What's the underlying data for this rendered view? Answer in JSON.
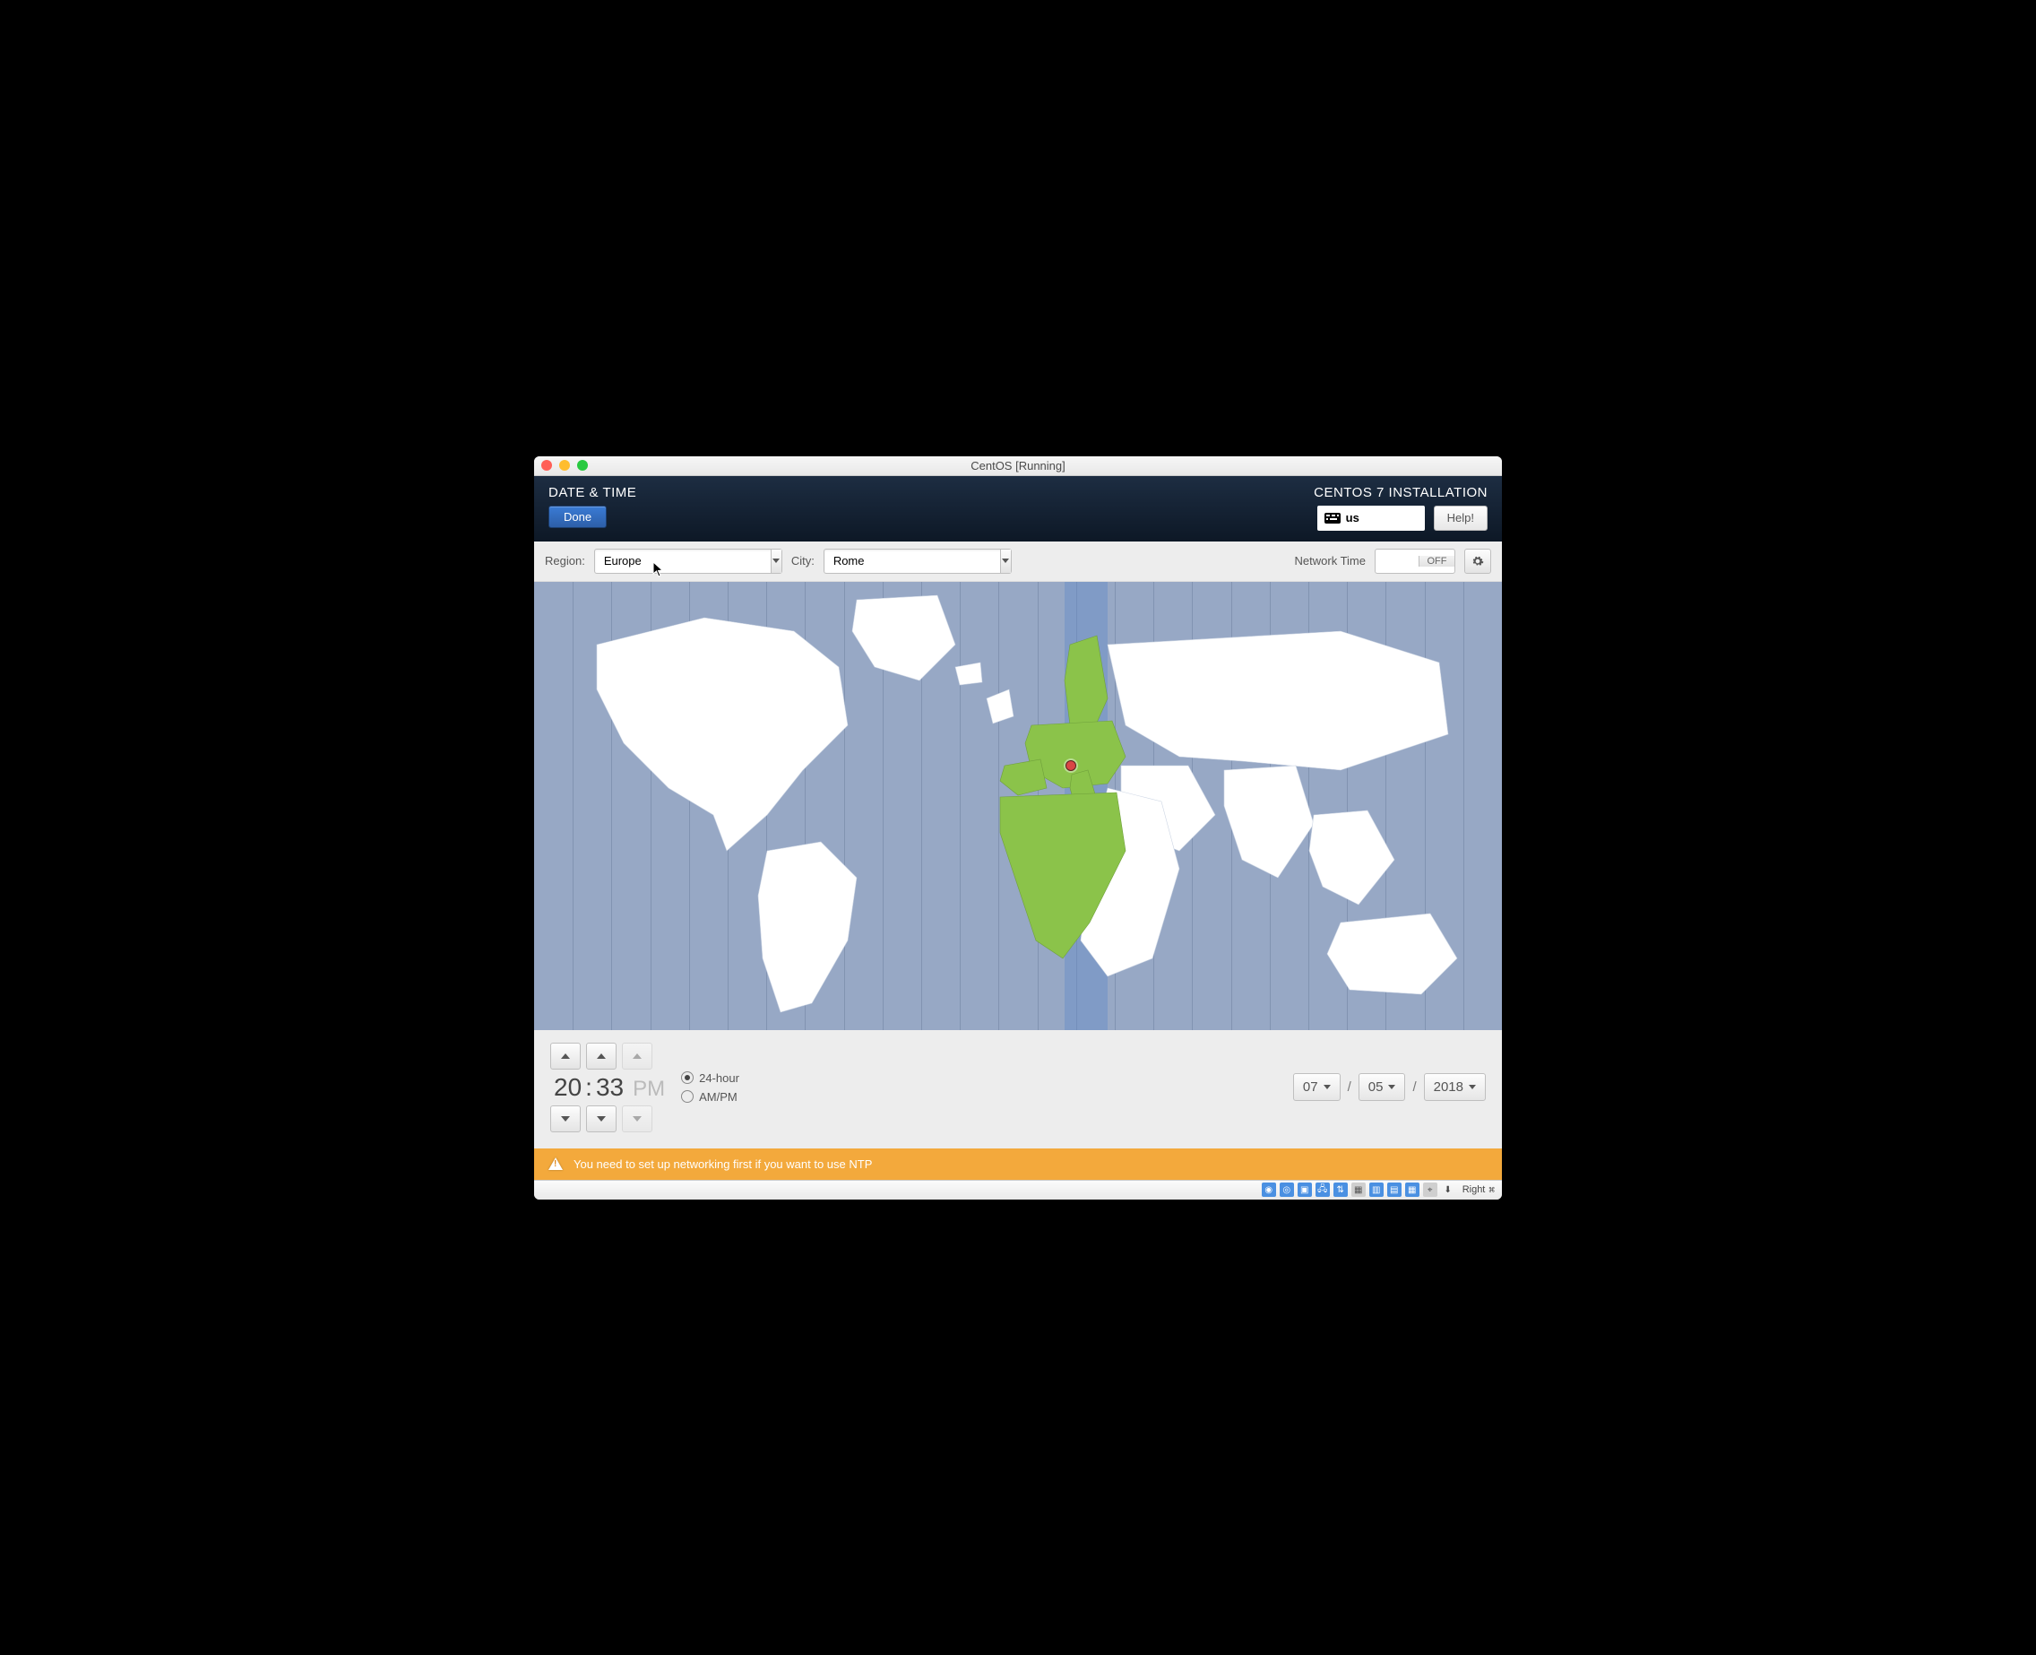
{
  "window": {
    "title": "CentOS [Running]"
  },
  "header": {
    "page_title": "DATE & TIME",
    "done_label": "Done",
    "install_title": "CENTOS 7 INSTALLATION",
    "keyboard_layout": "us",
    "help_label": "Help!"
  },
  "toolbar": {
    "region_label": "Region:",
    "region_value": "Europe",
    "city_label": "City:",
    "city_value": "Rome",
    "network_time_label": "Network Time",
    "network_time_state": "OFF"
  },
  "map": {
    "selected_city": "Rome",
    "highlighted_timezone": "UTC+1"
  },
  "time": {
    "hours": "20",
    "minutes": "33",
    "ampm": "PM",
    "colon": ":",
    "format_24h_label": "24-hour",
    "format_ampm_label": "AM/PM",
    "format_selected": "24-hour"
  },
  "date": {
    "month": "07",
    "day": "05",
    "year": "2018",
    "separator": "/"
  },
  "warning": {
    "text": "You need to set up networking first if you want to use NTP"
  },
  "statusbar": {
    "text": "Right",
    "cmd_glyph": "⌘"
  }
}
